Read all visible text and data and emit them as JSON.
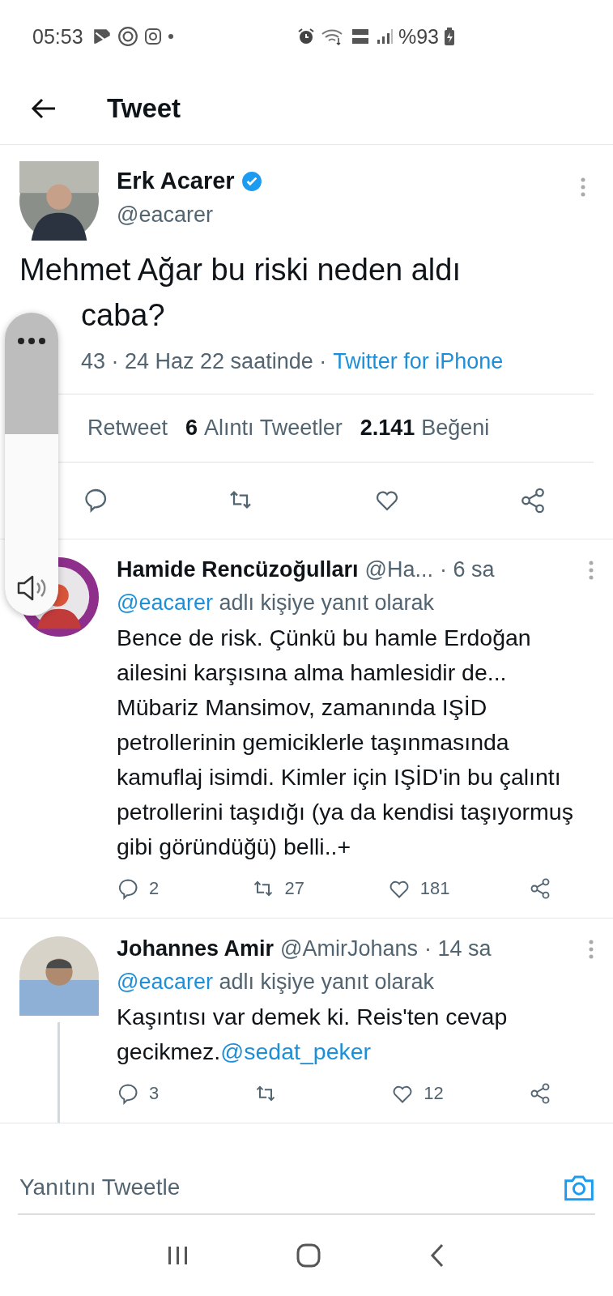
{
  "status_bar": {
    "time": "05:53",
    "battery": "%93"
  },
  "header": {
    "title": "Tweet"
  },
  "tweet": {
    "name": "Erk Acarer",
    "verified": true,
    "handle": "@eacarer",
    "text_lines": [
      "Mehmet Ağar bu riski neden aldı",
      "caba?"
    ],
    "meta": "43 · 24 Haz 22 saatinde ·",
    "source": "Twitter for iPhone",
    "stats": [
      {
        "label": "Retweet"
      },
      {
        "count": "6",
        "label": "Alıntı Tweetler"
      },
      {
        "count": "2.141",
        "label": "Beğeni"
      }
    ]
  },
  "volume_overlay": {
    "level": 0.6
  },
  "replies": [
    {
      "name": "Hamide Rencüzoğulları",
      "handle": "@Ha...",
      "time": "· 6 sa",
      "reply_to": "@eacarer",
      "reply_to_suffix": "adlı kişiye yanıt olarak",
      "text": "Bence de risk. Çünkü bu hamle Erdoğan ailesini karşısına alma hamlesidir de... Mübariz Mansimov, zamanında IŞİD petrollerinin gemiciklerle taşınmasında kamuflaj isimdi. Kimler için IŞİD'in bu çalıntı petrollerini taşıdığı (ya da kendisi taşıyormuş gibi göründüğü) belli..+",
      "replies": "2",
      "retweets": "27",
      "likes": "181",
      "thread": false
    },
    {
      "name": "Johannes Amir",
      "handle": "@AmirJohans",
      "time": "· 14 sa",
      "reply_to": "@eacarer",
      "reply_to_suffix": "adlı kişiye yanıt olarak",
      "text": "Kaşıntısı var demek ki. Reis'ten cevap gecikmez.",
      "mention": "@sedat_peker",
      "replies": "3",
      "likes": "12",
      "thread": true
    }
  ],
  "composer": {
    "placeholder": "Yanıtını Tweetle"
  }
}
